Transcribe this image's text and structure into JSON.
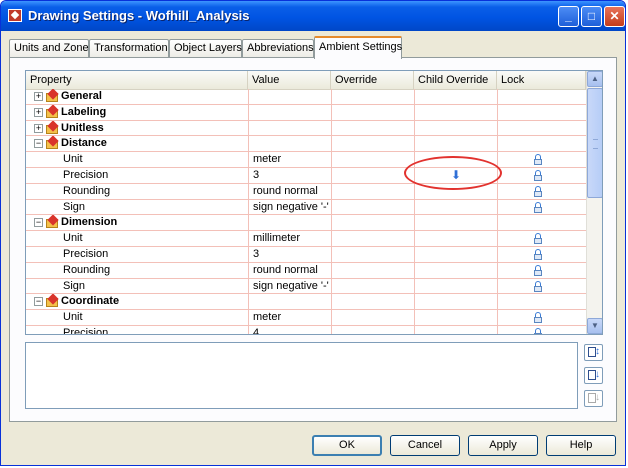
{
  "window": {
    "title": "Drawing Settings - Wofhill_Analysis",
    "minimize": "_",
    "maximize": "□",
    "close": "✕"
  },
  "tabs": [
    {
      "label": "Units and Zone"
    },
    {
      "label": "Transformation"
    },
    {
      "label": "Object Layers"
    },
    {
      "label": "Abbreviations"
    },
    {
      "label": "Ambient Settings",
      "active": true
    }
  ],
  "grid": {
    "columns": [
      "Property",
      "Value",
      "Override",
      "Child Override",
      "Lock"
    ],
    "rows": [
      {
        "type": "group",
        "expander": "+",
        "label": "General"
      },
      {
        "type": "group",
        "expander": "+",
        "label": "Labeling"
      },
      {
        "type": "group",
        "expander": "+",
        "label": "Unitless"
      },
      {
        "type": "group",
        "expander": "−",
        "label": "Distance"
      },
      {
        "type": "item",
        "label": "Unit",
        "value": "meter",
        "lock": true
      },
      {
        "type": "item",
        "label": "Precision",
        "value": "3",
        "child_override": true,
        "lock": true
      },
      {
        "type": "item",
        "label": "Rounding",
        "value": "round normal",
        "lock": true
      },
      {
        "type": "item",
        "label": "Sign",
        "value": "sign negative '-'",
        "lock": true
      },
      {
        "type": "group",
        "expander": "−",
        "label": "Dimension"
      },
      {
        "type": "item",
        "label": "Unit",
        "value": "millimeter",
        "lock": true
      },
      {
        "type": "item",
        "label": "Precision",
        "value": "3",
        "lock": true
      },
      {
        "type": "item",
        "label": "Rounding",
        "value": "round normal",
        "lock": true
      },
      {
        "type": "item",
        "label": "Sign",
        "value": "sign negative '-'",
        "lock": true
      },
      {
        "type": "group",
        "expander": "−",
        "label": "Coordinate"
      },
      {
        "type": "item",
        "label": "Unit",
        "value": "meter",
        "lock": true
      },
      {
        "type": "item",
        "label": "Precision",
        "value": "4",
        "lock": true
      }
    ]
  },
  "buttons": {
    "ok": "OK",
    "cancel": "Cancel",
    "apply": "Apply",
    "help": "Help"
  },
  "colors": {
    "title_bar": "#0054e3",
    "grid_line": "#f3c0b8",
    "highlight": "#e2322e"
  }
}
